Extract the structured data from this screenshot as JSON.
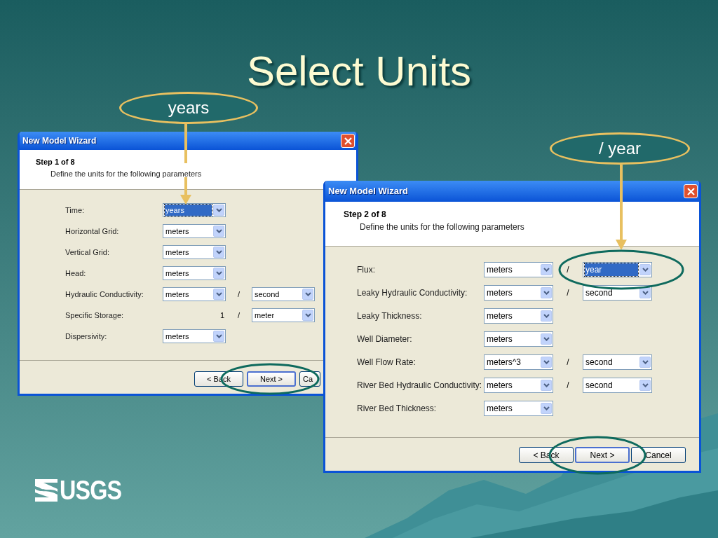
{
  "slide": {
    "title": "Select Units"
  },
  "callouts": [
    {
      "text": "years"
    },
    {
      "text": "/ year"
    }
  ],
  "dialogs": [
    {
      "title": "New Model Wizard",
      "step": "Step 1 of 8",
      "description": "Define the units for the following parameters",
      "rows": [
        {
          "label": "Time:",
          "unit": {
            "value": "years",
            "selected": true
          }
        },
        {
          "label": "Horizontal Grid:",
          "unit": {
            "value": "meters",
            "selected": false
          }
        },
        {
          "label": "Vertical Grid:",
          "unit": {
            "value": "meters",
            "selected": false
          }
        },
        {
          "label": "Head:",
          "unit": {
            "value": "meters",
            "selected": false
          }
        },
        {
          "label": "Hydraulic Conductivity:",
          "unit": {
            "value": "meters",
            "selected": false
          },
          "separator": "/",
          "per": {
            "value": "second",
            "selected": false
          }
        },
        {
          "label": "Specific Storage:",
          "unit_text": "1",
          "separator": "/",
          "per": {
            "value": "meter",
            "selected": false
          }
        },
        {
          "label": "Dispersivity:",
          "unit": {
            "value": "meters",
            "selected": false
          }
        }
      ],
      "buttons": [
        {
          "label": "< Back",
          "default": false
        },
        {
          "label": "Next >",
          "default": true
        },
        {
          "label": "Ca",
          "default": false
        }
      ]
    },
    {
      "title": "New Model Wizard",
      "step": "Step 2 of 8",
      "description": "Define the units for the following parameters",
      "rows": [
        {
          "label": "Flux:",
          "unit": {
            "value": "meters",
            "selected": false
          },
          "separator": "/",
          "per": {
            "value": "year",
            "selected": true
          }
        },
        {
          "label": "Leaky Hydraulic Conductivity:",
          "unit": {
            "value": "meters",
            "selected": false
          },
          "separator": "/",
          "per": {
            "value": "second",
            "selected": false
          }
        },
        {
          "label": "Leaky Thickness:",
          "unit": {
            "value": "meters",
            "selected": false
          }
        },
        {
          "label": "Well Diameter:",
          "unit": {
            "value": "meters",
            "selected": false
          }
        },
        {
          "label": "Well Flow Rate:",
          "unit": {
            "value": "meters^3",
            "selected": false
          },
          "separator": "/",
          "per": {
            "value": "second",
            "selected": false
          }
        },
        {
          "label": "River Bed Hydraulic Conductivity:",
          "unit": {
            "value": "meters",
            "selected": false
          },
          "separator": "/",
          "per": {
            "value": "second",
            "selected": false
          }
        },
        {
          "label": "River Bed Thickness:",
          "unit": {
            "value": "meters",
            "selected": false
          }
        }
      ],
      "buttons": [
        {
          "label": "< Back",
          "default": false
        },
        {
          "label": "Next >",
          "default": true
        },
        {
          "label": "Cancel",
          "default": false
        }
      ]
    }
  ],
  "logo": {
    "text": "USGS"
  }
}
